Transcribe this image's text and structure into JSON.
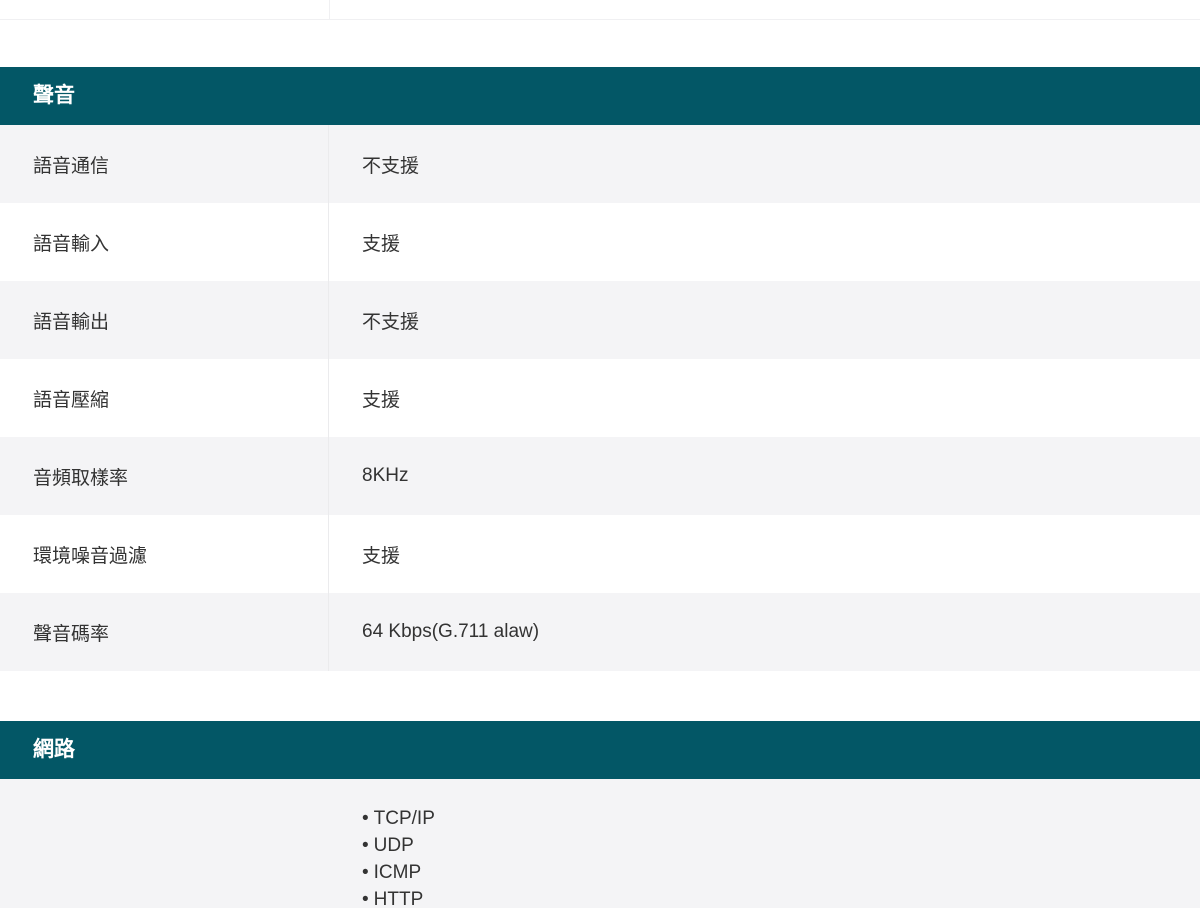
{
  "audio": {
    "title": "聲音",
    "rows": [
      {
        "label": "語音通信",
        "value": "不支援"
      },
      {
        "label": "語音輸入",
        "value": "支援"
      },
      {
        "label": "語音輸出",
        "value": "不支援"
      },
      {
        "label": "語音壓縮",
        "value": "支援"
      },
      {
        "label": "音頻取樣率",
        "value": "8KHz"
      },
      {
        "label": "環境噪音過濾",
        "value": "支援"
      },
      {
        "label": "聲音碼率",
        "value": "64 Kbps(G.711 alaw)"
      }
    ]
  },
  "network": {
    "title": "網路",
    "rows": [
      {
        "label": "",
        "protocols": [
          "TCP/IP",
          "UDP",
          "ICMP",
          "HTTP"
        ]
      }
    ]
  }
}
